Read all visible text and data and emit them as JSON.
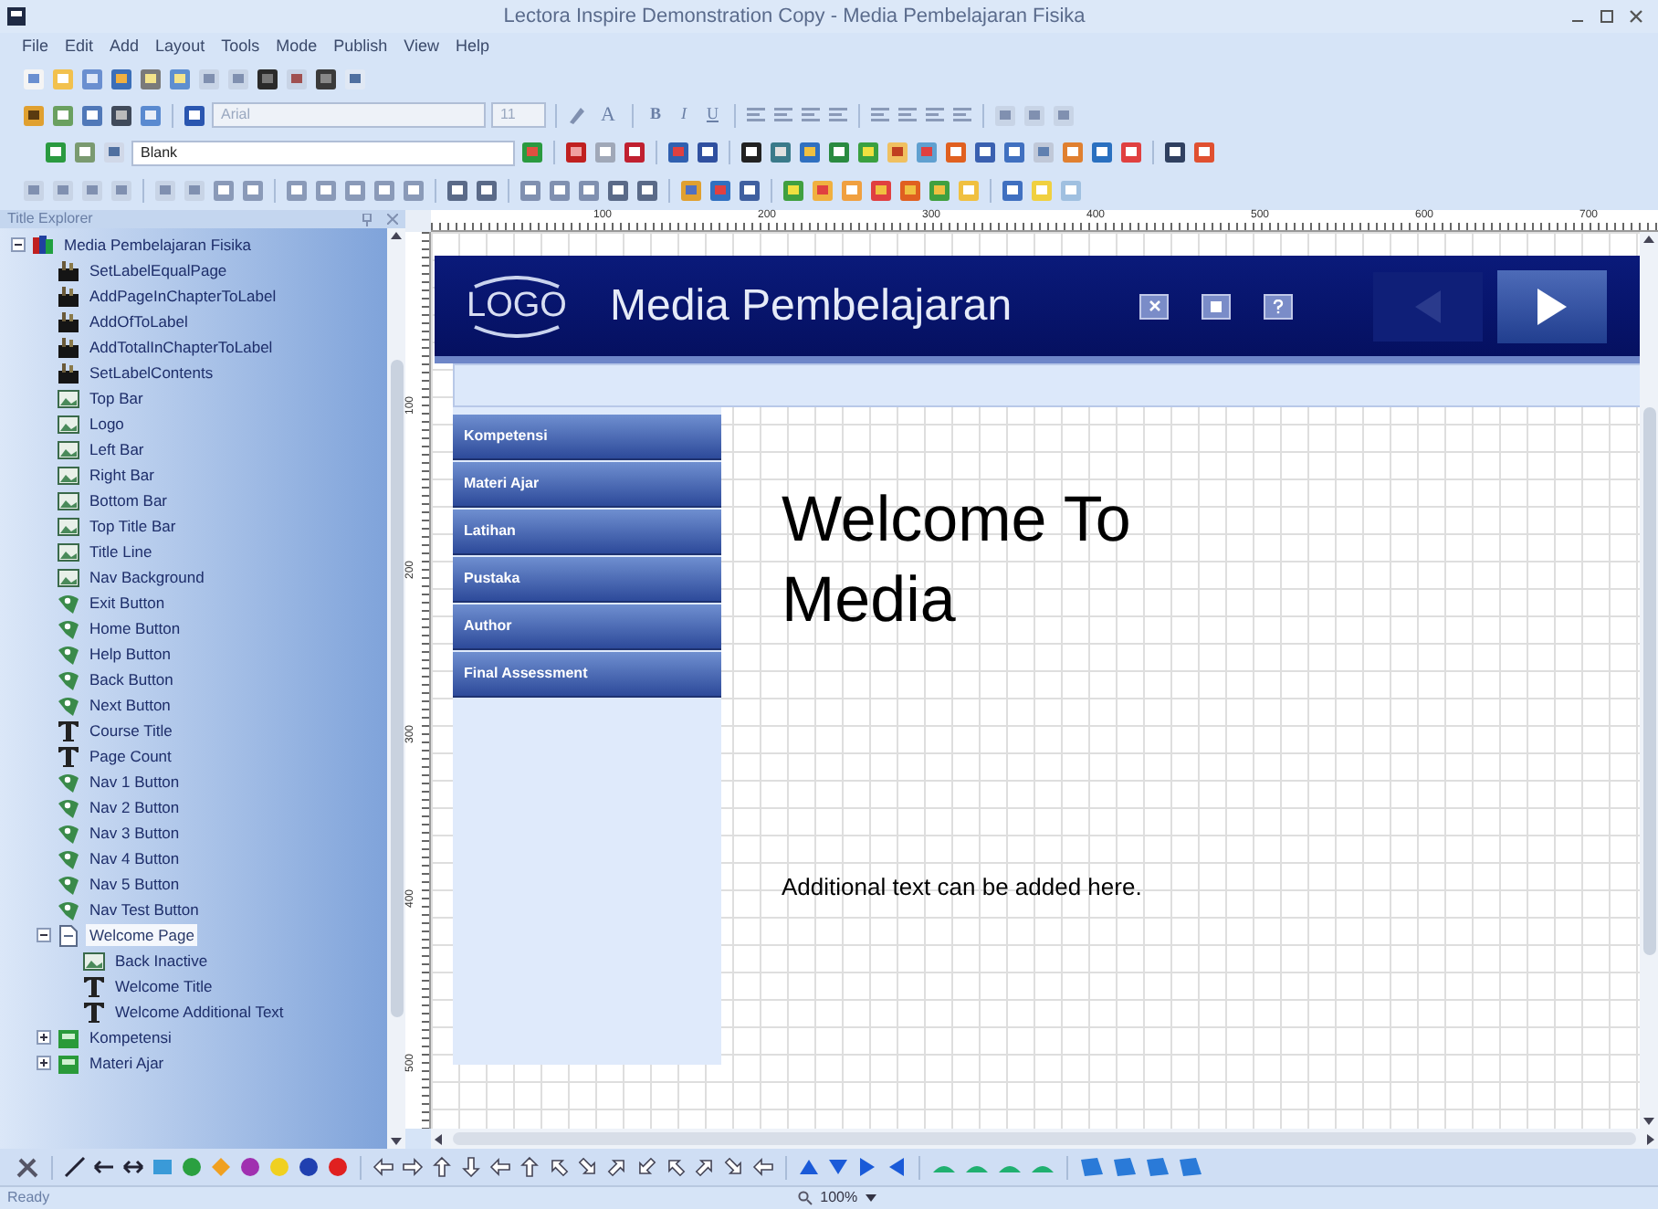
{
  "window": {
    "title": "Lectora Inspire Demonstration Copy - Media Pembelajaran Fisika"
  },
  "menu": [
    "File",
    "Edit",
    "Add",
    "Layout",
    "Tools",
    "Mode",
    "Publish",
    "View",
    "Help"
  ],
  "toolbars": {
    "font_dropdown": "Arial",
    "size_dropdown": "11",
    "font_color_button": "A",
    "format_buttons": [
      "B",
      "I",
      "U"
    ],
    "style_dropdown": "Blank"
  },
  "title_explorer": {
    "title": "Title Explorer",
    "tree": {
      "label": "Media Pembelajaran Fisika",
      "kind": "title",
      "expanded": true,
      "selected": false,
      "children": [
        {
          "label": "SetLabelEqualPage",
          "kind": "action",
          "selected": false
        },
        {
          "label": "AddPageInChapterToLabel",
          "kind": "action",
          "selected": false
        },
        {
          "label": "AddOfToLabel",
          "kind": "action",
          "selected": false
        },
        {
          "label": "AddTotalInChapterToLabel",
          "kind": "action",
          "selected": false
        },
        {
          "label": "SetLabelContents",
          "kind": "action",
          "selected": false
        },
        {
          "label": "Top Bar",
          "kind": "image",
          "selected": false
        },
        {
          "label": "Logo",
          "kind": "image",
          "selected": false
        },
        {
          "label": "Left Bar",
          "kind": "image",
          "selected": false
        },
        {
          "label": "Right Bar",
          "kind": "image",
          "selected": false
        },
        {
          "label": "Bottom Bar",
          "kind": "image",
          "selected": false
        },
        {
          "label": "Top Title Bar",
          "kind": "image",
          "selected": false
        },
        {
          "label": "Title Line",
          "kind": "image",
          "selected": false
        },
        {
          "label": "Nav Background",
          "kind": "image",
          "selected": false
        },
        {
          "label": "Exit Button",
          "kind": "button",
          "selected": false
        },
        {
          "label": "Home Button",
          "kind": "button",
          "selected": false
        },
        {
          "label": "Help Button",
          "kind": "button",
          "selected": false
        },
        {
          "label": "Back Button",
          "kind": "button",
          "selected": false
        },
        {
          "label": "Next Button",
          "kind": "button",
          "selected": false
        },
        {
          "label": "Course Title",
          "kind": "text",
          "selected": false
        },
        {
          "label": "Page Count",
          "kind": "text",
          "selected": false
        },
        {
          "label": "Nav 1 Button",
          "kind": "button",
          "selected": false
        },
        {
          "label": "Nav 2 Button",
          "kind": "button",
          "selected": false
        },
        {
          "label": "Nav 3 Button",
          "kind": "button",
          "selected": false
        },
        {
          "label": "Nav 4 Button",
          "kind": "button",
          "selected": false
        },
        {
          "label": "Nav 5 Button",
          "kind": "button",
          "selected": false
        },
        {
          "label": "Nav Test Button",
          "kind": "button",
          "selected": false
        },
        {
          "label": "Welcome Page",
          "kind": "page",
          "expanded": true,
          "selected": true,
          "children": [
            {
              "label": "Back Inactive",
              "kind": "image",
              "selected": false
            },
            {
              "label": "Welcome Title",
              "kind": "text",
              "selected": false
            },
            {
              "label": "Welcome Additional Text",
              "kind": "text",
              "selected": false
            }
          ]
        },
        {
          "label": "Kompetensi",
          "kind": "chapter",
          "expanded": false,
          "selected": false
        },
        {
          "label": "Materi Ajar",
          "kind": "chapter",
          "expanded": false,
          "selected": false
        }
      ]
    }
  },
  "ruler": {
    "horizontal": [
      "100",
      "200",
      "300",
      "400",
      "500",
      "600",
      "700"
    ],
    "vertical": [
      "100",
      "200",
      "300",
      "400",
      "500"
    ]
  },
  "page": {
    "logo": "LOGO",
    "title": "Media Pembelajaran",
    "nav": [
      "Kompetensi",
      "Materi Ajar",
      "Latihan",
      "Pustaka",
      "Author",
      "Final Assessment"
    ],
    "welcome_title": "Welcome To Media",
    "additional_text": "Additional text can be added here."
  },
  "status_bar": {
    "text": "Ready",
    "zoom": "100%"
  }
}
